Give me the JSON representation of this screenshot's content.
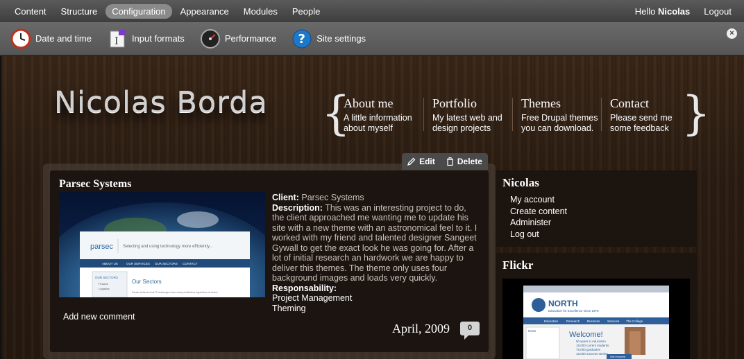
{
  "toolbar": {
    "menu": [
      {
        "label": "Content",
        "active": false
      },
      {
        "label": "Structure",
        "active": false
      },
      {
        "label": "Configuration",
        "active": true
      },
      {
        "label": "Appearance",
        "active": false
      },
      {
        "label": "Modules",
        "active": false
      },
      {
        "label": "People",
        "active": false
      }
    ],
    "hello_prefix": "Hello",
    "user_name": "Nicolas",
    "logout_label": "Logout",
    "close_label": "×",
    "shortcuts": [
      {
        "label": "Date and time",
        "icon": "clock-icon"
      },
      {
        "label": "Input formats",
        "icon": "input-formats-icon"
      },
      {
        "label": "Performance",
        "icon": "gauge-icon"
      },
      {
        "label": "Site settings",
        "icon": "help-icon"
      }
    ]
  },
  "site": {
    "title": "Nicolas Borda",
    "nav": [
      {
        "title": "About me",
        "desc": "A little information about myself"
      },
      {
        "title": "Portfolio",
        "desc": "My latest web and design projects"
      },
      {
        "title": "Themes",
        "desc": "Free Drupal themes you can download."
      },
      {
        "title": "Contact",
        "desc": "Please send me some feedback"
      }
    ]
  },
  "node": {
    "tabs": {
      "edit": "Edit",
      "delete": "Delete"
    },
    "title": "Parsec Systems",
    "client_label": "Client:",
    "client_value": "Parsec Systems",
    "description_label": "Description:",
    "description_value": "This was an interesting project to do, the client approached me wanting me to update his site with a new theme with an astronomical feel to it. I worked with my friend and talented designer Sangeet Gywall to get the exact look he was going for. After a lot of initial research an hardwork we are happy to deliver this themes. The theme only uses four background images and loads very quickly.",
    "responsability_label": "Responsability:",
    "roles": [
      "Project Management",
      "Theming"
    ],
    "add_comment": "Add new comment",
    "date": "April, 2009",
    "comment_count": "0",
    "image": {
      "logo": "parsec",
      "tagline": "Selecting and using technology more efficiently...",
      "nav": [
        "ABOUT US",
        "OUR SERVICES",
        "OUR SECTORS",
        "CONTACT"
      ],
      "sidebar_title": "OUR SECTORS",
      "sidebar_items": [
        "Finance",
        "Logistics"
      ],
      "heading": "Our Sectors",
      "body": "Parsec believes that IT challenges have many similarities regardless of sector."
    }
  },
  "sidebar": {
    "user_block": {
      "title": "Nicolas",
      "links": [
        "My account",
        "Create content",
        "Administer",
        "Log out"
      ]
    },
    "flickr_block": {
      "title": "Flickr",
      "shot": {
        "logo": "NORTH",
        "tagline": "Education for Excellence since 1975",
        "nav": [
          "Education",
          "Research",
          "Business",
          "Services",
          "The College"
        ],
        "welcome": "Welcome!",
        "facts": [
          "50 years in education",
          "15,000 current students",
          "75,000 graduates",
          "15,000 success stories"
        ],
        "news_title": "News",
        "button": "Get involved"
      }
    }
  },
  "colors": {
    "toolbar_bg": "#4a4a4a",
    "active_menu": "#8a8a8a",
    "wood_bg": "#2c1d12",
    "panel_bg": "#1b1410"
  }
}
